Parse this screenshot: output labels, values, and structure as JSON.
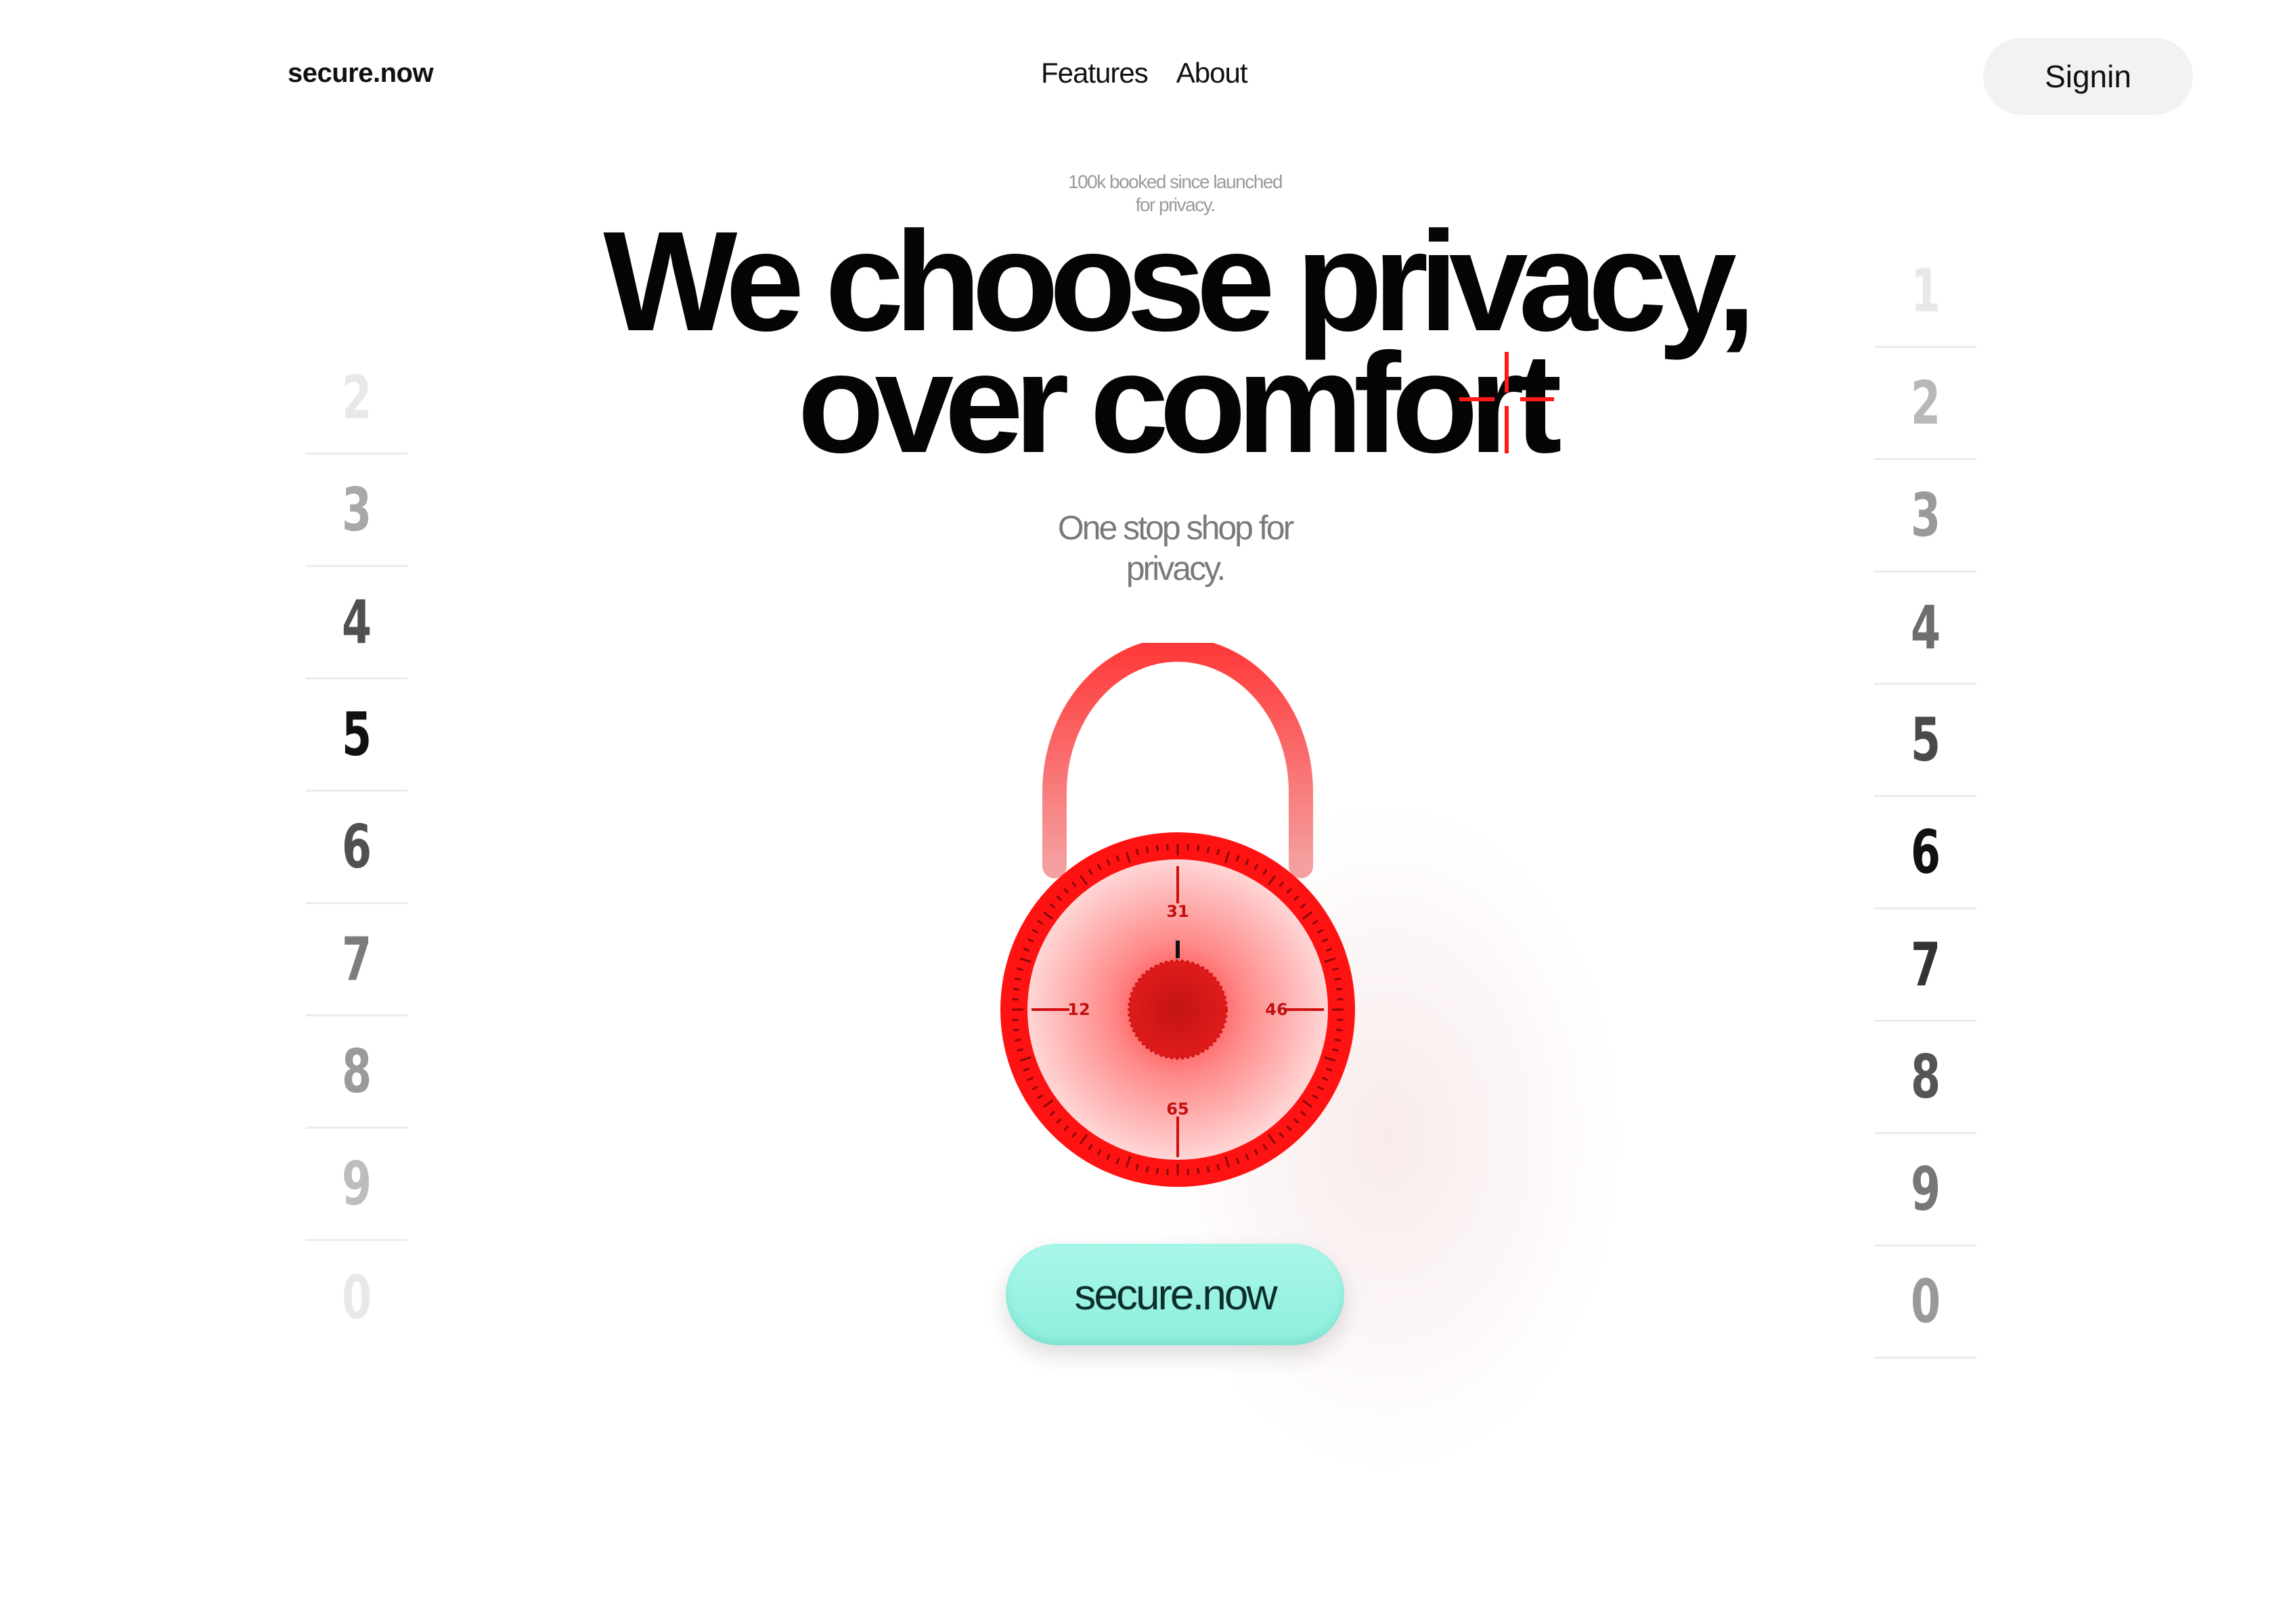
{
  "header": {
    "logo": "secure.now",
    "nav": [
      "Features",
      "About"
    ],
    "signin_label": "Signin"
  },
  "hero": {
    "tagline_line1": "100k booked since launched",
    "tagline_line2": "for privacy.",
    "headline_line1": "We choose privacy,",
    "headline_line2": "over comfort",
    "subhead_line1": "One stop shop for",
    "subhead_line2": "privacy."
  },
  "lock": {
    "dial_numbers": [
      "31",
      "46",
      "65",
      "12"
    ],
    "accent_color": "#ff1a1a"
  },
  "wheel_left": [
    "2",
    "3",
    "4",
    "5",
    "6",
    "7",
    "8",
    "9",
    "0"
  ],
  "wheel_right": [
    "1",
    "2",
    "3",
    "4",
    "5",
    "6",
    "7",
    "8",
    "9",
    "0"
  ],
  "cta": {
    "label": "secure.now",
    "color": "#a2f5e6"
  }
}
